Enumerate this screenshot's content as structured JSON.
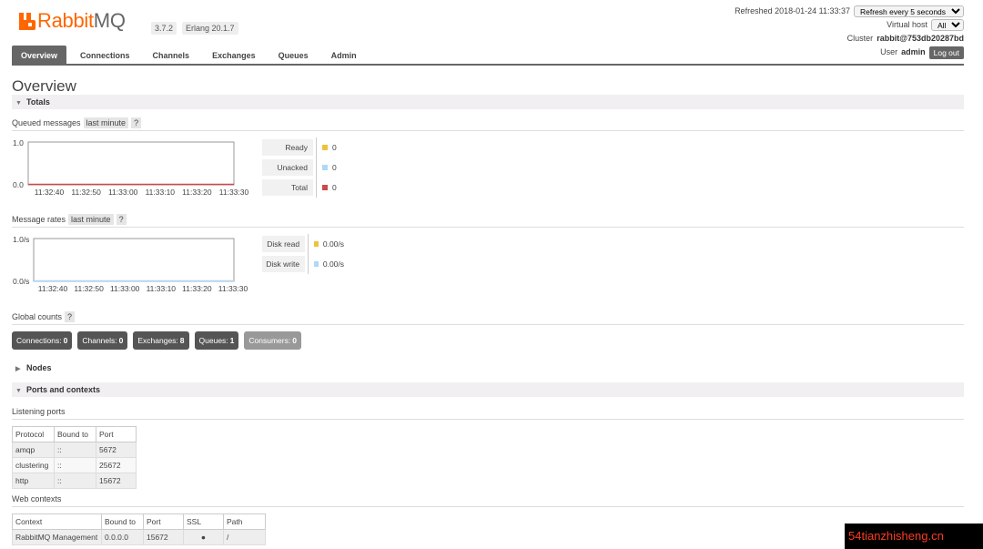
{
  "header": {
    "brand_rabbit": "Rabbit",
    "brand_mq": "MQ",
    "version": "3.7.2",
    "erlang": "Erlang 20.1.7",
    "refreshed_label": "Refreshed 2018-01-24 11:33:37",
    "refresh_option": "Refresh every 5 seconds",
    "vhost_label": "Virtual host",
    "vhost_value": "All",
    "cluster_label": "Cluster",
    "cluster_value": "rabbit@753db20287bd",
    "user_label": "User",
    "user_value": "admin",
    "logout": "Log out"
  },
  "tabs": [
    "Overview",
    "Connections",
    "Channels",
    "Exchanges",
    "Queues",
    "Admin"
  ],
  "active_tab": "Overview",
  "page_title": "Overview",
  "totals": {
    "section_title": "Totals",
    "queued": {
      "label": "Queued messages",
      "range_chip": "last minute",
      "help": "?",
      "y_top": "1.0",
      "y_bottom": "0.0",
      "x_ticks": [
        "11:32:40",
        "11:32:50",
        "11:33:00",
        "11:33:10",
        "11:33:20",
        "11:33:30"
      ],
      "legend": [
        {
          "label": "Ready",
          "value": "0",
          "color": "#edc240"
        },
        {
          "label": "Unacked",
          "value": "0",
          "color": "#afd8f8"
        },
        {
          "label": "Total",
          "value": "0",
          "color": "#cb4b4b"
        }
      ]
    },
    "rates": {
      "label": "Message rates",
      "range_chip": "last minute",
      "help": "?",
      "y_top": "1.0/s",
      "y_bottom": "0.0/s",
      "x_ticks": [
        "11:32:40",
        "11:32:50",
        "11:33:00",
        "11:33:10",
        "11:33:20",
        "11:33:30"
      ],
      "legend": [
        {
          "label": "Disk read",
          "value": "0.00/s",
          "color": "#edc240"
        },
        {
          "label": "Disk write",
          "value": "0.00/s",
          "color": "#afd8f8"
        }
      ]
    },
    "global": {
      "label": "Global counts",
      "help": "?",
      "items": [
        {
          "label": "Connections:",
          "value": "0"
        },
        {
          "label": "Channels:",
          "value": "0"
        },
        {
          "label": "Exchanges:",
          "value": "8"
        },
        {
          "label": "Queues:",
          "value": "1"
        },
        {
          "label": "Consumers:",
          "value": "0"
        }
      ]
    }
  },
  "nodes": {
    "section_title": "Nodes"
  },
  "ports": {
    "section_title": "Ports and contexts",
    "listening_label": "Listening ports",
    "listening_headers": [
      "Protocol",
      "Bound to",
      "Port"
    ],
    "listening_rows": [
      [
        "amqp",
        "::",
        "5672"
      ],
      [
        "clustering",
        "::",
        "25672"
      ],
      [
        "http",
        "::",
        "15672"
      ]
    ],
    "web_label": "Web contexts",
    "web_headers": [
      "Context",
      "Bound to",
      "Port",
      "SSL",
      "Path"
    ],
    "web_rows": [
      [
        "RabbitMQ Management",
        "0.0.0.0",
        "15672",
        "●",
        "/"
      ]
    ]
  },
  "watermark": "54tianzhisheng.cn"
}
